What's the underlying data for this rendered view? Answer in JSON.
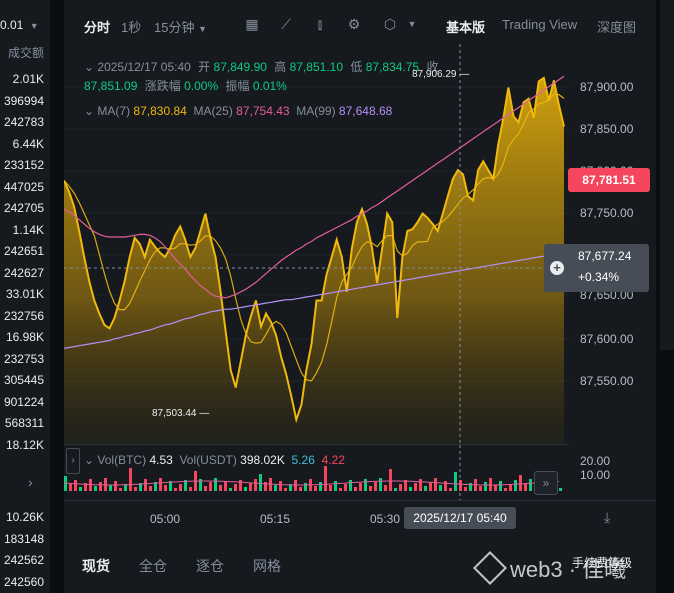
{
  "orderbook": {
    "selector": "0.01",
    "header": "成交额",
    "rows": [
      "2.01K",
      "396994",
      "242783",
      "6.44K",
      "233152",
      "447025",
      "242705",
      "1.14K",
      "242651",
      "242627",
      "33.01K",
      "232756",
      "16.98K",
      "232753",
      "305445",
      "901224",
      "568311",
      "18.12K"
    ],
    "bottom_rows": [
      "10.26K",
      "183148",
      "242562",
      "242560"
    ]
  },
  "toolbar": {
    "time_label": "分时",
    "sec_label": "1秒",
    "interval_label": "15分钟",
    "basic_label": "基本版",
    "tradingview_label": "Trading View",
    "depth_label": "深度图"
  },
  "ohlc": {
    "datetime": "2025/12/17 05:40",
    "open_label": "开",
    "open": "87,849.90",
    "high_label": "高",
    "high": "87,851.10",
    "low_label": "低",
    "low": "87,834.75",
    "close_label": "收",
    "close": "87,851.09",
    "change_label": "涨跌幅",
    "change": "0.00%",
    "amp_label": "振幅",
    "amp": "0.01%"
  },
  "ma": {
    "ma7_label": "MA(7)",
    "ma7": "87,830.84",
    "ma25_label": "MA(25)",
    "ma25": "87,754.43",
    "ma99_label": "MA(99)",
    "ma99": "87,648.68"
  },
  "price_axis": {
    "ticks": [
      "87,900.00",
      "87,850.00",
      "87,800.00",
      "87,750.00",
      "87,650.00",
      "87,600.00",
      "87,550.00"
    ],
    "last_price": "87,781.51",
    "hover_price": "87,677.24",
    "hover_change": "+0.34%"
  },
  "annotations": {
    "high": "87,906.29",
    "low": "87,503.44"
  },
  "volume": {
    "vol_btc_label": "Vol(BTC)",
    "vol_btc": "4.53",
    "vol_usdt_label": "Vol(USDT)",
    "vol_usdt": "398.02K",
    "ma1": "5.26",
    "ma2": "4.22",
    "ticks": [
      "20.00",
      "10.00"
    ]
  },
  "time_axis": {
    "ticks": [
      "05:00",
      "05:15",
      "05:30"
    ],
    "hover_time": "2025/12/17 05:40"
  },
  "bottom_tabs": {
    "spot": "现货",
    "cross": "全仓",
    "isolated": "逐仓",
    "grid": "网格",
    "fee": "手续费等级"
  },
  "watermark": {
    "text": "web3 · 佳曦"
  },
  "chart_data": {
    "type": "area",
    "title": "",
    "ylim": [
      87475,
      87935
    ],
    "x": [
      0,
      1,
      2,
      3,
      4,
      5,
      6,
      7,
      8,
      9,
      10,
      11,
      12,
      13,
      14,
      15,
      16,
      17,
      18,
      19,
      20,
      21,
      22,
      23,
      24,
      25,
      26,
      27,
      28,
      29,
      30,
      31,
      32,
      33,
      34,
      35,
      36,
      37,
      38,
      39,
      40,
      41,
      42,
      43,
      44,
      45,
      46,
      47,
      48,
      49,
      50,
      51,
      52,
      53,
      54,
      55,
      56,
      57,
      58,
      59,
      60,
      61,
      62,
      63,
      64,
      65,
      66,
      67,
      68,
      69,
      70,
      71,
      72,
      73,
      74,
      75,
      76,
      77,
      78,
      79,
      80,
      81,
      82,
      83,
      84,
      85,
      86,
      87,
      88,
      89,
      90,
      91,
      92,
      93,
      94,
      95,
      96,
      97,
      98,
      99
    ],
    "series": [
      {
        "values": [
          87778,
          87765,
          87748,
          87720,
          87690,
          87662,
          87640,
          87625,
          87612,
          87608,
          87620,
          87640,
          87662,
          87690,
          87712,
          87705,
          87690,
          87710,
          87702,
          87695,
          87690,
          87700,
          87715,
          87725,
          87710,
          87690,
          87700,
          87720,
          87740,
          87712,
          87690,
          87650,
          87605,
          87560,
          87540,
          87570,
          87600,
          87622,
          87640,
          87610,
          87625,
          87615,
          87600,
          87575,
          87555,
          87530,
          87503,
          87520,
          87560,
          87590,
          87640,
          87640,
          87670,
          87690,
          87710,
          87690,
          87650,
          87700,
          87730,
          87745,
          87728,
          87700,
          87660,
          87700,
          87740,
          87730,
          87620,
          87690,
          87720,
          87722,
          87730,
          87740,
          87735,
          87728,
          87720,
          87740,
          87760,
          87780,
          87790,
          87785,
          87760,
          87755,
          87790,
          87800,
          87790,
          87780,
          87820,
          87850,
          87885,
          87852,
          87845,
          87868,
          87872,
          87850,
          87892,
          87896,
          87870,
          87893,
          87865,
          87840
        ]
      },
      {
        "values": [
          87745,
          87742,
          87738,
          87733,
          87728,
          87723,
          87719,
          87716,
          87714,
          87713,
          87713,
          87713,
          87713,
          87714,
          87715,
          87716,
          87716,
          87715,
          87712,
          87708,
          87702,
          87695,
          87688,
          87682,
          87676,
          87669,
          87663,
          87657,
          87653,
          87648,
          87645,
          87644,
          87643,
          87645,
          87647,
          87650,
          87653,
          87657,
          87661,
          87666,
          87671,
          87676,
          87681,
          87686,
          87690,
          87694,
          87698,
          87701,
          87705,
          87708,
          87712,
          87715,
          87718,
          87721,
          87724,
          87727,
          87730,
          87733,
          87737,
          87740,
          87743,
          87747,
          87750,
          87754,
          87758,
          87762,
          87766,
          87770,
          87774,
          87778,
          87782,
          87786,
          87790,
          87794,
          87798,
          87802,
          87806,
          87810,
          87814,
          87818,
          87822,
          87826,
          87830,
          87834,
          87838,
          87842,
          87846,
          87850,
          87854,
          87858,
          87862,
          87866,
          87870,
          87874,
          87878,
          87882,
          87886,
          87890,
          87894,
          87898
        ]
      },
      {
        "values": [
          87585,
          87586,
          87587,
          87588,
          87589,
          87590,
          87591,
          87592,
          87593,
          87594,
          87596,
          87597,
          87599,
          87600,
          87602,
          87603,
          87605,
          87606,
          87608,
          87610,
          87612,
          87613,
          87615,
          87617,
          87619,
          87620,
          87622,
          87624,
          87625,
          87627,
          87628,
          87629,
          87630,
          87630,
          87631,
          87632,
          87633,
          87634,
          87635,
          87636,
          87637,
          87638,
          87639,
          87640,
          87641,
          87641,
          87642,
          87643,
          87644,
          87645,
          87646,
          87647,
          87648,
          87649,
          87650,
          87651,
          87652,
          87653,
          87654,
          87655,
          87656,
          87657,
          87658,
          87659,
          87660,
          87661,
          87662,
          87663,
          87664,
          87665,
          87666,
          87667,
          87668,
          87669,
          87670,
          87671,
          87672,
          87673,
          87674,
          87675,
          87676,
          87677,
          87678,
          87679,
          87680,
          87681,
          87682,
          87683,
          87684,
          87685,
          87686,
          87687,
          87688,
          87689,
          87690,
          87691,
          87692,
          87693,
          87694,
          87695
        ]
      }
    ]
  },
  "colors": {
    "up": "#0ecb81",
    "down": "#f6465d",
    "gold": "#f0b90b",
    "ma25": "#e35d9b",
    "ma99": "#b38ff5"
  }
}
